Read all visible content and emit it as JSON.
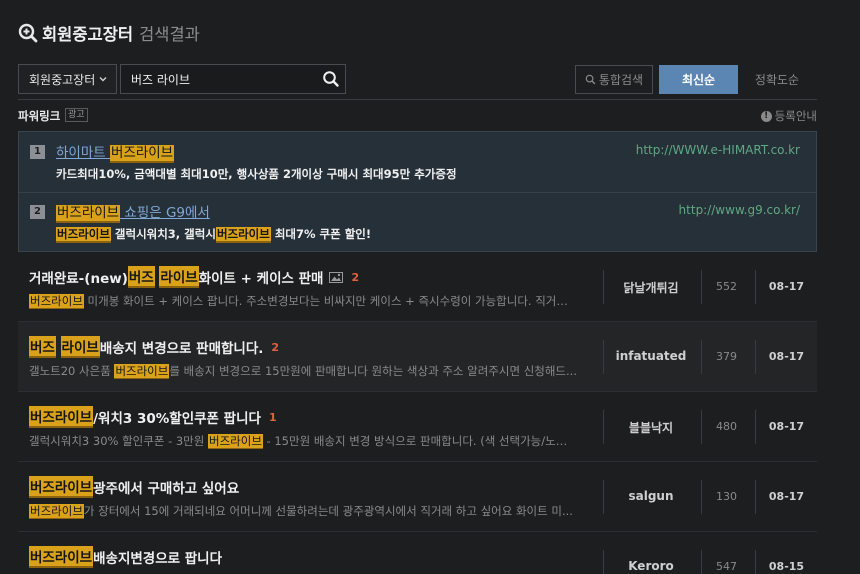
{
  "header": {
    "title": "회원중고장터",
    "subtitle": "검색결과"
  },
  "search": {
    "scope_label": "회원중고장터",
    "query": "버즈 라이브",
    "integrated_label": "통합검색",
    "sort_latest": "최신순",
    "sort_accuracy": "정확도순"
  },
  "powerlink": {
    "title": "파워링크",
    "ad_badge": "광고",
    "info_label": "등록안내",
    "ads": [
      {
        "num": "1",
        "title_pre": "하이마트 ",
        "title_hl": "버즈라이브",
        "title_post": "",
        "desc": "카드최대10%, 금액대별 최대10만, 행사상품 2개이상 구매시 최대95만 추가증정",
        "url": "http://WWW.e-HIMART.co.kr"
      },
      {
        "num": "2",
        "title_pre": "",
        "title_hl": "버즈라이브",
        "title_post": " 쇼핑은 G9에서",
        "desc_hl1": "버즈라이브",
        "desc_mid": " 갤럭시워치3, 갤럭시",
        "desc_hl2": "버즈라이브",
        "desc_post": " 최대7% 쿠폰 할인!",
        "url": "http://www.g9.co.kr/"
      }
    ]
  },
  "posts": [
    {
      "t_pre": "거래완료-(new) ",
      "t_hl1": "버즈",
      "t_mid": " ",
      "t_hl2": "라이브",
      "t_post": " 화이트 + 케이스 판매",
      "count": "2",
      "d_hl": "버즈라이브",
      "d_post": " 미개봉 화이트 + 케이스 팝니다. 주소변경보다는 비싸지만 케이스 + 즉시수령이 가능합니다. 직거래...",
      "author": "닭날개튀김",
      "views": "552",
      "date": "08-17"
    },
    {
      "t_hl1": "버즈",
      "t_mid": " ",
      "t_hl2": "라이브",
      "t_post": " 배송지 변경으로 판매합니다.",
      "count": "2",
      "d_pre": "갤노트20 사은품 ",
      "d_hl": "버즈라이브",
      "d_post": "를 배송지 변경으로 15만원에 판매합니다 원하는 색상과 주소 알려주시면 신청해드...",
      "author": "infatuated",
      "views": "379",
      "date": "08-17"
    },
    {
      "t_hl1": "버즈라이브",
      "t_post": "/워치3 30%할인쿠폰 팝니다",
      "count": "1",
      "d_pre": "갤럭시워치3 30% 할인쿠폰 - 3만원 ",
      "d_hl": "버즈라이브",
      "d_post": " - 15만원 배송지 변경 방식으로 판매합니다. (색 선택가능/노트 2...",
      "author": "블블낙지",
      "views": "480",
      "date": "08-17"
    },
    {
      "t_hl1": "버즈라이브",
      "t_post": " 광주에서 구매하고 싶어요",
      "d_hl": "버즈라이브",
      "d_post": "가 장터에서 15에 거래되네요 어머니께 선물하려는데 광주광역시에서 직거래 하고 싶어요 화이트 미...",
      "author": "salgun",
      "views": "130",
      "date": "08-17"
    },
    {
      "t_hl1": "버즈라이브",
      "t_post": " 배송지변경으로 팝니다",
      "d_post": "",
      "author": "Keroro",
      "views": "547",
      "date": "08-15"
    }
  ],
  "colors": {
    "highlight": "#d9a21a",
    "accent": "#5b86b4",
    "count": "#e0623c",
    "ad_url": "#5fa882",
    "ad_title": "#7fa8d8"
  }
}
